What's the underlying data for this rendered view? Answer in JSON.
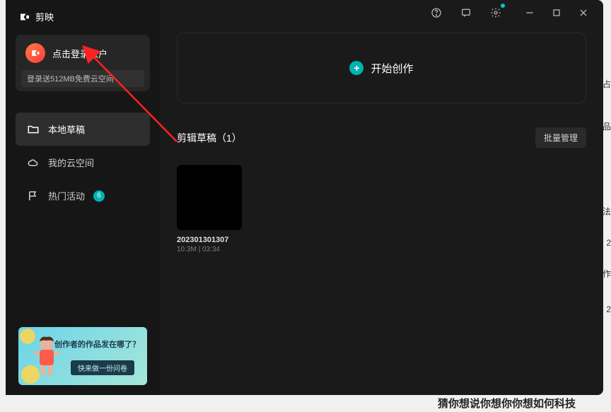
{
  "app": {
    "name": "剪映"
  },
  "login": {
    "label": "点击登录账户",
    "subtext": "登录送512MB免费云空间"
  },
  "sidebar": {
    "items": [
      {
        "icon": "folder-icon",
        "label": "本地草稿",
        "active": true
      },
      {
        "icon": "cloud-icon",
        "label": "我的云空间",
        "active": false
      },
      {
        "icon": "flag-icon",
        "label": "热门活动",
        "active": false,
        "badge": "6"
      }
    ]
  },
  "promo": {
    "text": "创作者的作品发在哪了？",
    "cta": "快来做一份问卷"
  },
  "titlebar": {
    "icons": [
      "help-icon",
      "message-icon",
      "settings-icon"
    ],
    "window": [
      "minimize-icon",
      "maximize-icon",
      "close-icon"
    ]
  },
  "create": {
    "label": "开始创作"
  },
  "drafts": {
    "title_prefix": "剪辑草稿",
    "count": "（1）",
    "batch_label": "批量管理",
    "items": [
      {
        "name": "202301301307",
        "size": "10.3M",
        "duration": "03:34"
      }
    ]
  },
  "background_text": "猜你想说你想你你想如何科技",
  "colors": {
    "accent": "#00b3b3",
    "annotation": "#ff2222"
  }
}
